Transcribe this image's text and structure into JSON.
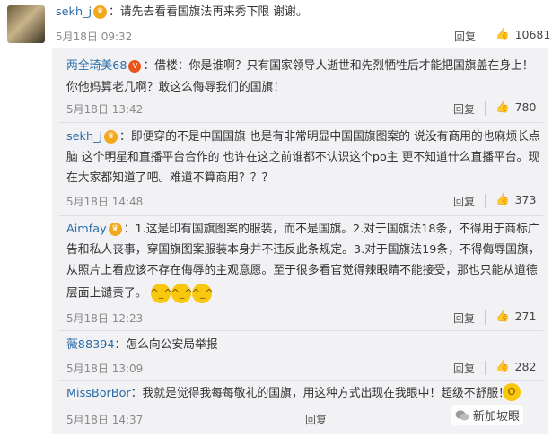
{
  "top": {
    "user": "sekh_j",
    "text": "：请先去看看国旗法再来秀下限 谢谢。",
    "date": "5月18日 09:32",
    "reply_label": "回复",
    "likes": "10681"
  },
  "replies": [
    {
      "user": "两全琦美68",
      "lines": [
        "：借楼：你是谁啊？只有国家领导人逝世和先烈牺牲后才能把国旗盖在身上！",
        "你他妈算老几啊？敢这么侮辱我们的国旗！"
      ],
      "date": "5月18日 13:42",
      "likes": "780"
    },
    {
      "user": "sekh_j",
      "lines": [
        "：即便穿的不是中国国旗 也是有非常明显中国国旗图案的 说没有商用的也麻烦长点",
        "脑 这个明星和直播平台合作的 也许在这之前谁都不认识这个po主 更不知道什么直播平台。现",
        "在大家都知道了吧。难道不算商用？？？"
      ],
      "date": "5月18日 14:48",
      "likes": "373"
    },
    {
      "user": "Aimfay",
      "lines": [
        "：1.这是印有国旗图案的服装，而不是国旗。2.对于国旗法18条，不得用于商标广",
        "告和私人丧事，穿国旗图案服装本身并不违反此条规定。3.对于国旗法19条，不得侮辱国旗，",
        "从照片上看应该不存在侮辱的主观意愿。至于很多看官觉得辣眼睛不能接受，那也只能从道德",
        "层面上谴责了。"
      ],
      "date": "5月18日 12:23",
      "likes": "271"
    },
    {
      "user": "薇88394",
      "lines": [
        "：怎么向公安局举报"
      ],
      "date": "5月18日 13:09",
      "likes": "282"
    },
    {
      "user": "MissBorBor",
      "lines": [
        "：我就是觉得我每每敬礼的国旗，用这种方式出现在我眼中！超级不舒服！"
      ],
      "date": "5月18日 14:37",
      "likes": ""
    }
  ],
  "reply_label": "回复",
  "watermark": "新加坡眼"
}
